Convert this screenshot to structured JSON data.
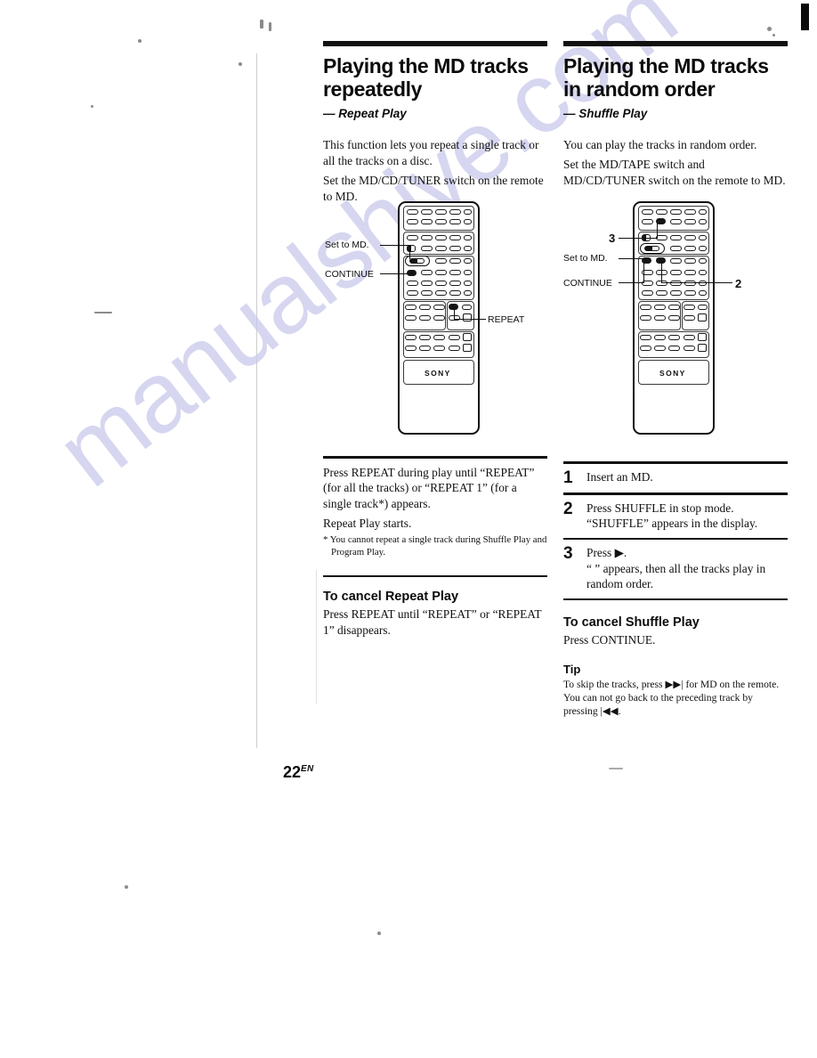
{
  "page": {
    "number": "22",
    "number_suffix": "EN",
    "watermark": "manualshive.com"
  },
  "left_column": {
    "title": "Playing the MD tracks repeatedly",
    "subtitle": "— Repeat Play",
    "intro": [
      "This function lets you repeat a single track or all the tracks on a disc.",
      "Set the MD/CD/TUNER switch on the remote to MD."
    ],
    "diagram": {
      "callouts": [
        {
          "label": "Set to MD."
        },
        {
          "label": "CONTINUE"
        },
        {
          "label": "REPEAT"
        }
      ],
      "brand": "SONY"
    },
    "instructions": [
      "Press REPEAT during play until “REPEAT” (for all the tracks) or “REPEAT 1” (for a single track*) appears.",
      "Repeat Play starts."
    ],
    "footnote": "* You cannot repeat a single track during Shuffle Play and Program Play.",
    "cancel_heading": "To cancel Repeat Play",
    "cancel_body": "Press REPEAT until “REPEAT” or “REPEAT 1” disappears."
  },
  "right_column": {
    "title": "Playing the MD tracks in random order",
    "subtitle": "— Shuffle Play",
    "intro": [
      "You can play the tracks in random order.",
      "Set the MD/TAPE switch and MD/CD/TUNER switch on the remote to MD."
    ],
    "diagram": {
      "callouts": [
        {
          "label": "3"
        },
        {
          "label": "Set to MD."
        },
        {
          "label": "CONTINUE"
        },
        {
          "label": "2"
        }
      ],
      "brand": "SONY"
    },
    "steps": [
      {
        "num": "1",
        "main": "Insert an MD.",
        "sub": ""
      },
      {
        "num": "2",
        "main": "Press SHUFFLE in stop mode.",
        "sub": "“SHUFFLE” appears in the display."
      },
      {
        "num": "3",
        "main": "Press ▶.",
        "sub": "“ ” appears, then all the tracks play in random order."
      }
    ],
    "cancel_heading": "To cancel Shuffle Play",
    "cancel_body": "Press CONTINUE.",
    "tip_heading": "Tip",
    "tip_body": "To skip the tracks, press ▶▶| for MD on the remote. You can not go back to the preceding track by pressing |◀◀."
  }
}
